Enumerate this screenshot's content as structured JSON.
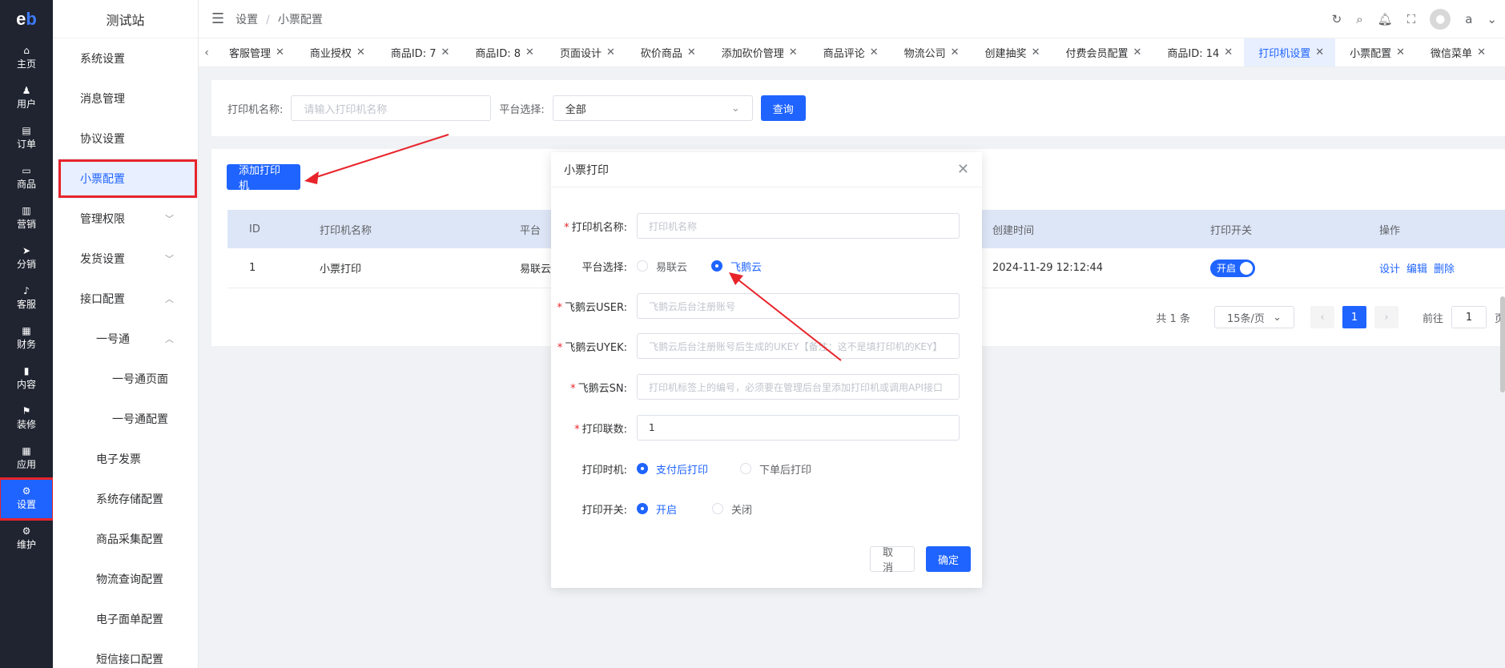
{
  "logo": {
    "a": "e",
    "b": "b"
  },
  "site_name": "测试站",
  "rail": [
    {
      "icon": "home-icon",
      "label": "主页"
    },
    {
      "icon": "user-icon",
      "label": "用户"
    },
    {
      "icon": "order-icon",
      "label": "订单"
    },
    {
      "icon": "goods-icon",
      "label": "商品"
    },
    {
      "icon": "marketing-icon",
      "label": "营销"
    },
    {
      "icon": "distribution-icon",
      "label": "分销"
    },
    {
      "icon": "service-icon",
      "label": "客服"
    },
    {
      "icon": "finance-icon",
      "label": "财务"
    },
    {
      "icon": "content-icon",
      "label": "内容"
    },
    {
      "icon": "decorate-icon",
      "label": "装修"
    },
    {
      "icon": "apps-icon",
      "label": "应用"
    },
    {
      "icon": "gear-icon",
      "label": "设置"
    },
    {
      "icon": "maintain-icon",
      "label": "维护"
    }
  ],
  "submenu": [
    {
      "label": "系统设置",
      "level": 1,
      "chev": ""
    },
    {
      "label": "消息管理",
      "level": 1,
      "chev": ""
    },
    {
      "label": "协议设置",
      "level": 1,
      "chev": ""
    },
    {
      "label": "小票配置",
      "level": 1,
      "chev": ""
    },
    {
      "label": "管理权限",
      "level": 1,
      "chev": "﹀"
    },
    {
      "label": "发货设置",
      "level": 1,
      "chev": "﹀"
    },
    {
      "label": "接口配置",
      "level": 1,
      "chev": "︿"
    },
    {
      "label": "一号通",
      "level": 2,
      "chev": "︿"
    },
    {
      "label": "一号通页面",
      "level": 3,
      "chev": ""
    },
    {
      "label": "一号通配置",
      "level": 3,
      "chev": ""
    },
    {
      "label": "电子发票",
      "level": 2,
      "chev": ""
    },
    {
      "label": "系统存储配置",
      "level": 2,
      "chev": ""
    },
    {
      "label": "商品采集配置",
      "level": 2,
      "chev": ""
    },
    {
      "label": "物流查询配置",
      "level": 2,
      "chev": ""
    },
    {
      "label": "电子面单配置",
      "level": 2,
      "chev": ""
    },
    {
      "label": "短信接口配置",
      "level": 2,
      "chev": ""
    }
  ],
  "breadcrumb": {
    "root": "设置",
    "sep": "/",
    "current": "小票配置"
  },
  "user": {
    "name": "a"
  },
  "tabs": [
    "客服管理",
    "商业授权",
    "商品ID: 7",
    "商品ID: 8",
    "页面设计",
    "砍价商品",
    "添加砍价管理",
    "商品评论",
    "物流公司",
    "创建抽奖",
    "付费会员配置",
    "商品ID: 14",
    "打印机设置",
    "小票配置",
    "微信菜单"
  ],
  "search": {
    "name_label": "打印机名称:",
    "name_placeholder": "请输入打印机名称",
    "platform_label": "平台选择:",
    "platform_value": "全部",
    "query_btn": "查询"
  },
  "add_btn": "添加打印机",
  "table": {
    "headers": [
      "ID",
      "打印机名称",
      "平台",
      "创建时间",
      "打印开关",
      "操作"
    ],
    "rows": [
      {
        "id": "1",
        "name": "小票打印",
        "platform": "易联云",
        "created": "2024-11-29 12:12:44",
        "switch": "开启",
        "actions": [
          "设计",
          "编辑",
          "删除"
        ]
      }
    ]
  },
  "pager": {
    "total": "共 1 条",
    "size": "15条/页",
    "current": "1",
    "goto": "前往",
    "goto_val": "1",
    "page_suffix": "页"
  },
  "modal": {
    "title": "小票打印",
    "fields": {
      "name_label": "打印机名称:",
      "name_placeholder": "打印机名称",
      "platform_label": "平台选择:",
      "platform_opts": [
        "易联云",
        "飞鹅云"
      ],
      "user_label": "飞鹅云USER:",
      "user_placeholder": "飞鹅云后台注册账号",
      "ukey_label": "飞鹅云UYEK:",
      "ukey_placeholder": "飞鹅云后台注册账号后生成的UKEY【备注：这不是填打印机的KEY】",
      "sn_label": "飞鹅云SN:",
      "sn_placeholder": "打印机标签上的编号，必须要在管理后台里添加打印机或调用API接口",
      "copies_label": "打印联数:",
      "copies_value": "1",
      "timing_label": "打印时机:",
      "timing_opts": [
        "支付后打印",
        "下单后打印"
      ],
      "switch_label": "打印开关:",
      "switch_opts": [
        "开启",
        "关闭"
      ]
    },
    "cancel": "取消",
    "confirm": "确定"
  },
  "annotation_color": "#e8242b",
  "accent": "#1f64ff"
}
